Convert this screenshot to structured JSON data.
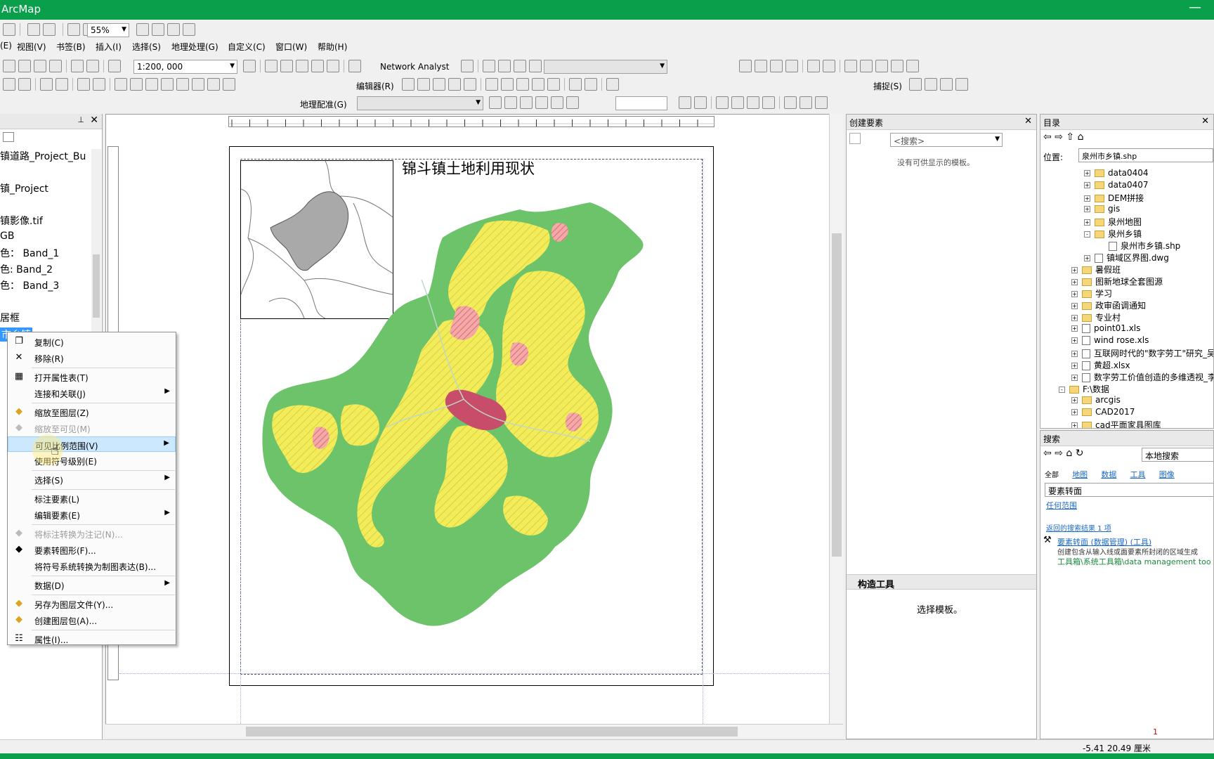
{
  "titlebar": {
    "title": "ArcMap",
    "controls": "—"
  },
  "toolbar1": {
    "zoom": "55%"
  },
  "menu": [
    "(E)",
    "视图(V)",
    "书签(B)",
    "插入(I)",
    "选择(S)",
    "地理处理(G)",
    "自定义(C)",
    "窗口(W)",
    "帮助(H)"
  ],
  "toolbar2": {
    "scale": "1:200, 000",
    "network_analyst": "Network Analyst"
  },
  "toolbar3": {
    "editor": "编辑器(R)",
    "snapping": "捕捉(S)"
  },
  "toolbar4": {
    "georef": "地理配准(G)"
  },
  "toc": {
    "items": [
      "镇道路_Project_Bu",
      "镇_Project",
      "镇影像.tif",
      "GB",
      "色：  Band_1",
      "色: Band_2",
      "色：  Band_3",
      "居框",
      "市乡镇"
    ]
  },
  "context_menu": {
    "items": [
      {
        "label": "复制(C)",
        "icon": "copy-icon"
      },
      {
        "label": "移除(R)",
        "icon": "remove-x-icon"
      },
      {
        "label": "打开属性表(T)",
        "icon": "table-icon"
      },
      {
        "label": "连接和关联(J)",
        "icon": "",
        "sub": true
      },
      {
        "label": "缩放至图层(Z)",
        "icon": "zoom-layer-icon"
      },
      {
        "label": "缩放至可见(M)",
        "icon": "zoom-visible-icon",
        "disabled": true
      },
      {
        "label": "可见比例范围(V)",
        "icon": "",
        "sub": true,
        "highlight": true
      },
      {
        "label": "使用符号级别(E)",
        "icon": ""
      },
      {
        "label": "选择(S)",
        "icon": "",
        "sub": true
      },
      {
        "label": "标注要素(L)",
        "icon": ""
      },
      {
        "label": "编辑要素(E)",
        "icon": "",
        "sub": true
      },
      {
        "label": "将标注转换为注记(N)...",
        "icon": "convert-label-icon",
        "disabled": true
      },
      {
        "label": "要素转图形(F)...",
        "icon": "feature-graphic-icon"
      },
      {
        "label": "将符号系统转换为制图表达(B)...",
        "icon": ""
      },
      {
        "label": "数据(D)",
        "icon": "",
        "sub": true
      },
      {
        "label": "另存为图层文件(Y)...",
        "icon": "layer-file-icon"
      },
      {
        "label": "创建图层包(A)...",
        "icon": "layer-package-icon"
      },
      {
        "label": "属性(I)...",
        "icon": "properties-icon"
      }
    ]
  },
  "layout": {
    "map_title": "锦斗镇土地利用现状"
  },
  "create_features": {
    "title": "创建要素",
    "search_placeholder": "<搜索>",
    "empty_msg": "没有可供显示的模板。",
    "construct_title": "构造工具",
    "construct_msg": "选择模板。"
  },
  "catalog": {
    "title": "目录",
    "location_label": "位置:",
    "location_value": "泉州市乡镇.shp",
    "tree": [
      {
        "label": "data0404",
        "indent": 2,
        "type": "folder",
        "pm": "+"
      },
      {
        "label": "data0407",
        "indent": 2,
        "type": "folder",
        "pm": "+"
      },
      {
        "label": "DEM拼接",
        "indent": 2,
        "type": "folder",
        "pm": "+"
      },
      {
        "label": "gis",
        "indent": 2,
        "type": "folder",
        "pm": "+"
      },
      {
        "label": "泉州地图",
        "indent": 2,
        "type": "folder",
        "pm": "+"
      },
      {
        "label": "泉州乡镇",
        "indent": 2,
        "type": "folder",
        "pm": "-"
      },
      {
        "label": "泉州市乡镇.shp",
        "indent": 3,
        "type": "file",
        "pm": ""
      },
      {
        "label": "镇域区界图.dwg",
        "indent": 2,
        "type": "file",
        "pm": "+"
      },
      {
        "label": "暑假班",
        "indent": 1,
        "type": "folder",
        "pm": "+"
      },
      {
        "label": "图新地球全套图源",
        "indent": 1,
        "type": "folder",
        "pm": "+"
      },
      {
        "label": "学习",
        "indent": 1,
        "type": "folder",
        "pm": "+"
      },
      {
        "label": "政审函调通知",
        "indent": 1,
        "type": "folder",
        "pm": "+"
      },
      {
        "label": "专业村",
        "indent": 1,
        "type": "folder",
        "pm": "+"
      },
      {
        "label": "point01.xls",
        "indent": 1,
        "type": "file",
        "pm": "+"
      },
      {
        "label": "wind rose.xls",
        "indent": 1,
        "type": "file",
        "pm": "+"
      },
      {
        "label": "互联网时代的\"数字劳工\"研究_吴",
        "indent": 1,
        "type": "file",
        "pm": "+"
      },
      {
        "label": "黄超.xlsx",
        "indent": 1,
        "type": "file",
        "pm": "+"
      },
      {
        "label": "数字劳工价值创造的多维透视_李",
        "indent": 1,
        "type": "file",
        "pm": "+"
      },
      {
        "label": "F:\\数据",
        "indent": 0,
        "type": "folder",
        "pm": "-"
      },
      {
        "label": "arcgis",
        "indent": 1,
        "type": "folder",
        "pm": "+"
      },
      {
        "label": "CAD2017",
        "indent": 1,
        "type": "folder",
        "pm": "+"
      },
      {
        "label": "cad平面家具图库",
        "indent": 1,
        "type": "folder",
        "pm": "+"
      }
    ]
  },
  "search": {
    "title": "搜索",
    "scope": "本地搜索",
    "tabs": [
      "全部",
      "地图",
      "数据",
      "工具",
      "图像"
    ],
    "query": "要素转面",
    "extent": "任何范围",
    "results_count": "返回的搜索结果 1 项",
    "result_title": "要素转面 (数据管理) (工具)",
    "result_desc": "创建包含从输入线或面要素所封闭的区域生成",
    "result_path": "工具箱\\系统工具箱\\data management too"
  },
  "status": {
    "coords": "-5.41  20.49 厘米",
    "page": "1"
  }
}
